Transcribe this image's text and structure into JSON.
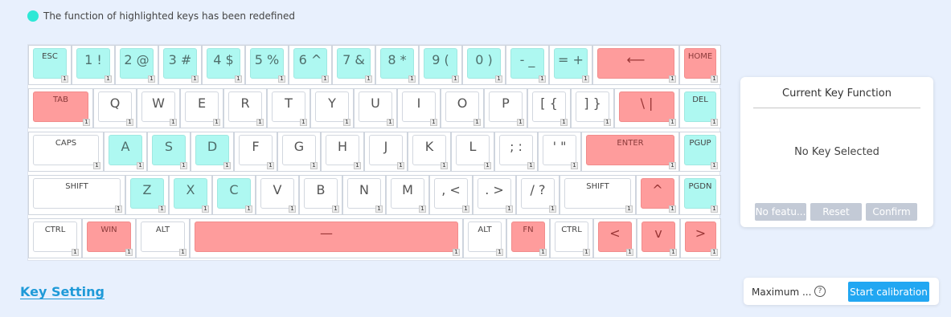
{
  "legend": {
    "text": "The function of highlighted keys has been redefined",
    "color": "#2ee8d6"
  },
  "colors": {
    "highlight_cyan": "#aef8f1",
    "highlight_red": "#fe9c9c",
    "accent": "#22a7f2"
  },
  "keyboard": {
    "rows": [
      [
        {
          "label": "ESC",
          "style": "cyan",
          "size": "small",
          "layer": "1"
        },
        {
          "label": "1 !",
          "style": "cyan",
          "size": "large",
          "layer": "1"
        },
        {
          "label": "2 @",
          "style": "cyan",
          "size": "large",
          "layer": "1"
        },
        {
          "label": "3 #",
          "style": "cyan",
          "size": "large",
          "layer": "1"
        },
        {
          "label": "4 $",
          "style": "cyan",
          "size": "large",
          "layer": "1"
        },
        {
          "label": "5 %",
          "style": "cyan",
          "size": "large",
          "layer": "1"
        },
        {
          "label": "6 ^",
          "style": "cyan",
          "size": "large",
          "layer": "1"
        },
        {
          "label": "7 &",
          "style": "cyan",
          "size": "large",
          "layer": "1"
        },
        {
          "label": "8 *",
          "style": "cyan",
          "size": "large",
          "layer": "1"
        },
        {
          "label": "9 (",
          "style": "cyan",
          "size": "large",
          "layer": "1"
        },
        {
          "label": "0 )",
          "style": "cyan",
          "size": "large",
          "layer": "1"
        },
        {
          "label": "- _",
          "style": "cyan",
          "size": "large",
          "layer": "1"
        },
        {
          "label": "= +",
          "style": "cyan",
          "size": "large",
          "layer": "1"
        },
        {
          "label": "⟵",
          "style": "red",
          "size": "large",
          "layer": "1"
        },
        {
          "label": "HOME",
          "style": "red",
          "size": "small",
          "layer": "1"
        }
      ],
      [
        {
          "label": "TAB",
          "style": "red",
          "size": "small",
          "layer": "1"
        },
        {
          "label": "Q",
          "style": "plain",
          "size": "large",
          "layer": "1"
        },
        {
          "label": "W",
          "style": "plain",
          "size": "large",
          "layer": "1"
        },
        {
          "label": "E",
          "style": "plain",
          "size": "large",
          "layer": "1"
        },
        {
          "label": "R",
          "style": "plain",
          "size": "large",
          "layer": "1"
        },
        {
          "label": "T",
          "style": "plain",
          "size": "large",
          "layer": "1"
        },
        {
          "label": "Y",
          "style": "plain",
          "size": "large",
          "layer": "1"
        },
        {
          "label": "U",
          "style": "plain",
          "size": "large",
          "layer": "1"
        },
        {
          "label": "I",
          "style": "plain",
          "size": "large",
          "layer": "1"
        },
        {
          "label": "O",
          "style": "plain",
          "size": "large",
          "layer": "1"
        },
        {
          "label": "P",
          "style": "plain",
          "size": "large",
          "layer": "1"
        },
        {
          "label": "[ {",
          "style": "plain",
          "size": "large",
          "layer": "1"
        },
        {
          "label": "] }",
          "style": "plain",
          "size": "large",
          "layer": "1"
        },
        {
          "label": "\\ |",
          "style": "red",
          "size": "large",
          "layer": "1"
        },
        {
          "label": "DEL",
          "style": "cyan",
          "size": "small",
          "layer": "1"
        }
      ],
      [
        {
          "label": "CAPS",
          "style": "plain",
          "size": "small",
          "layer": "1"
        },
        {
          "label": "A",
          "style": "cyan",
          "size": "large",
          "layer": "1"
        },
        {
          "label": "S",
          "style": "cyan",
          "size": "large",
          "layer": "1"
        },
        {
          "label": "D",
          "style": "cyan",
          "size": "large",
          "layer": "1"
        },
        {
          "label": "F",
          "style": "plain",
          "size": "large",
          "layer": "1"
        },
        {
          "label": "G",
          "style": "plain",
          "size": "large",
          "layer": "1"
        },
        {
          "label": "H",
          "style": "plain",
          "size": "large",
          "layer": "1"
        },
        {
          "label": "J",
          "style": "plain",
          "size": "large",
          "layer": "1"
        },
        {
          "label": "K",
          "style": "plain",
          "size": "large",
          "layer": "1"
        },
        {
          "label": "L",
          "style": "plain",
          "size": "large",
          "layer": "1"
        },
        {
          "label": "; :",
          "style": "plain",
          "size": "large",
          "layer": "1"
        },
        {
          "label": "' \"",
          "style": "plain",
          "size": "large",
          "layer": "1"
        },
        {
          "label": "ENTER",
          "style": "red",
          "size": "small",
          "layer": "1"
        },
        {
          "label": "PGUP",
          "style": "cyan",
          "size": "small",
          "layer": "1"
        }
      ],
      [
        {
          "label": "SHIFT",
          "style": "plain",
          "size": "small",
          "layer": "1"
        },
        {
          "label": "Z",
          "style": "cyan",
          "size": "large",
          "layer": "1"
        },
        {
          "label": "X",
          "style": "cyan",
          "size": "large",
          "layer": "1"
        },
        {
          "label": "C",
          "style": "cyan",
          "size": "large",
          "layer": "1"
        },
        {
          "label": "V",
          "style": "plain",
          "size": "large",
          "layer": "1"
        },
        {
          "label": "B",
          "style": "plain",
          "size": "large",
          "layer": "1"
        },
        {
          "label": "N",
          "style": "plain",
          "size": "large",
          "layer": "1"
        },
        {
          "label": "M",
          "style": "plain",
          "size": "large",
          "layer": "1"
        },
        {
          "label": ", <",
          "style": "plain",
          "size": "large",
          "layer": "1"
        },
        {
          "label": ". >",
          "style": "plain",
          "size": "large",
          "layer": "1"
        },
        {
          "label": "/ ?",
          "style": "plain",
          "size": "large",
          "layer": "1"
        },
        {
          "label": "SHIFT",
          "style": "plain",
          "size": "small",
          "layer": "1"
        },
        {
          "label": "^",
          "style": "red",
          "size": "large",
          "layer": "1"
        },
        {
          "label": "PGDN",
          "style": "cyan",
          "size": "small",
          "layer": "1"
        }
      ],
      [
        {
          "label": "CTRL",
          "style": "plain",
          "size": "small",
          "layer": "1"
        },
        {
          "label": "WIN",
          "style": "red",
          "size": "small",
          "layer": "1"
        },
        {
          "label": "ALT",
          "style": "plain",
          "size": "small",
          "layer": "1"
        },
        {
          "label": "—",
          "style": "red",
          "size": "large",
          "layer": "1"
        },
        {
          "label": "ALT",
          "style": "plain",
          "size": "small",
          "layer": "1"
        },
        {
          "label": "FN",
          "style": "red",
          "size": "small",
          "layer": "1"
        },
        {
          "label": "CTRL",
          "style": "plain",
          "size": "small",
          "layer": "1"
        },
        {
          "label": "<",
          "style": "red",
          "size": "large",
          "layer": "1"
        },
        {
          "label": "v",
          "style": "red",
          "size": "large",
          "layer": "1"
        },
        {
          "label": ">",
          "style": "red",
          "size": "large",
          "layer": "1"
        }
      ]
    ]
  },
  "panel": {
    "title": "Current Key Function",
    "status": "No Key Selected",
    "buttons": {
      "no_feature": "No featu...",
      "reset": "Reset",
      "confirm": "Confirm"
    }
  },
  "key_setting": {
    "label": "Key Setting"
  },
  "calibration": {
    "max_label": "Maximum ...",
    "help_icon": "?",
    "start_label": "Start calibration"
  }
}
